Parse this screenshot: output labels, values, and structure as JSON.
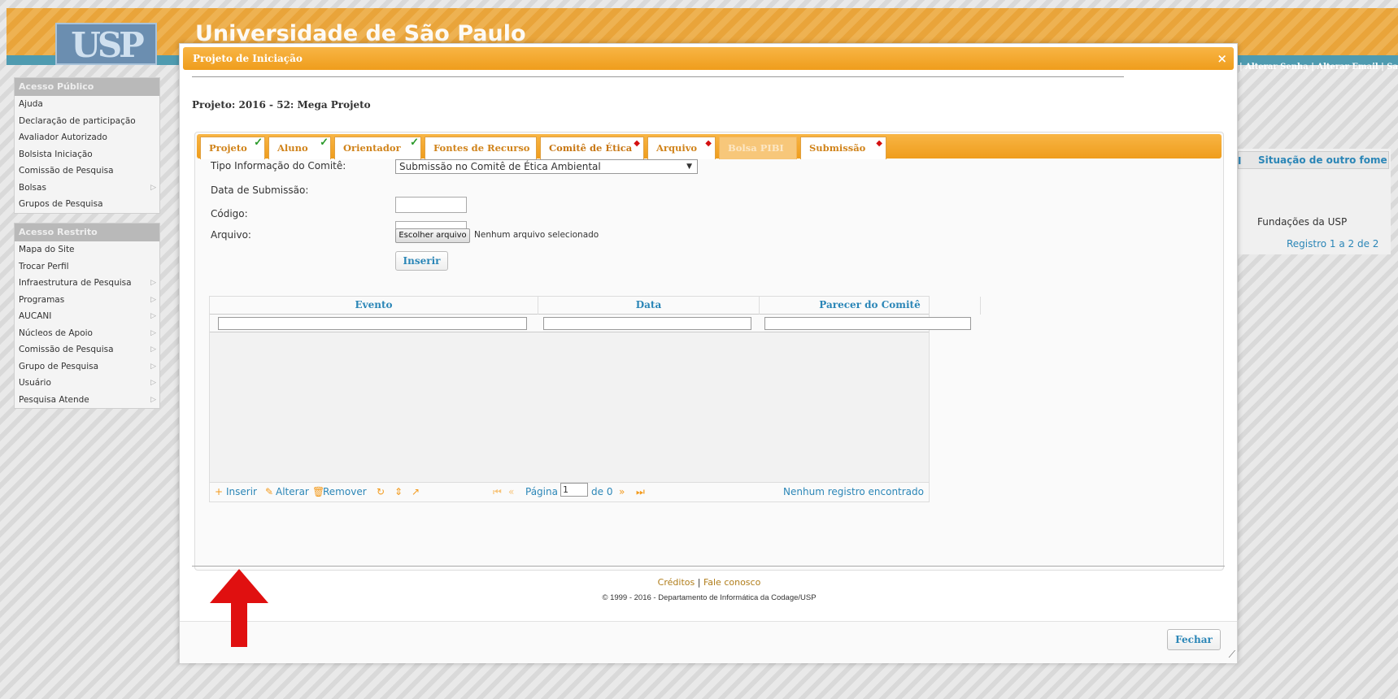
{
  "header": {
    "university": "Universidade de São Paulo",
    "logo_text": "USP",
    "top_links": "ce | Alterar Senha | Alterar Email | Sa"
  },
  "menu_public": {
    "title": "Acesso Público",
    "items": [
      "Ajuda",
      "Declaração de participação",
      "Avaliador Autorizado",
      "Bolsista Iniciação",
      "Comissão de Pesquisa",
      "Bolsas",
      "Grupos de Pesquisa"
    ]
  },
  "menu_restricted": {
    "title": "Acesso Restrito",
    "items": [
      "Mapa do Site",
      "Trocar Perfil",
      "Infraestrutura de Pesquisa",
      "Programas",
      "AUCANI",
      "Núcleos de Apoio",
      "Comissão de Pesquisa",
      "Grupo de Pesquisa",
      "Usuário",
      "Pesquisa Atende"
    ]
  },
  "background": {
    "col_head_short": "I",
    "col_head": "Situação de outro fome",
    "row_value": "Fundações da USP",
    "records": "Registro 1 a 2 de 2"
  },
  "modal": {
    "title": "Projeto de Iniciação",
    "close": "×",
    "project": "Projeto: 2016 - 52: Mega Projeto",
    "tabs": [
      {
        "label": "Projeto",
        "status": "ok"
      },
      {
        "label": "Aluno",
        "status": "ok"
      },
      {
        "label": "Orientador",
        "status": "ok"
      },
      {
        "label": "Fontes de Recurso",
        "status": ""
      },
      {
        "label": "Comitê de Ética",
        "status": "pending"
      },
      {
        "label": "Arquivo",
        "status": "pending"
      },
      {
        "label": "Bolsa PIBI",
        "status": "disabled"
      },
      {
        "label": "Submissão",
        "status": "pending"
      }
    ],
    "form": {
      "tipo_label": "Tipo Informação do Comitê:",
      "tipo_value": "Submissão no Comitê de Ética Ambiental",
      "data_label": "Data de Submissão:",
      "codigo_label": "Código:",
      "arquivo_label": "Arquivo:",
      "file_button": "Escolher arquivo",
      "file_none": "Nenhum arquivo selecionado",
      "insert_button": "Inserir"
    },
    "grid": {
      "columns": [
        "Evento",
        "Data",
        "Parecer do Comitê"
      ],
      "pager": {
        "insert": "Inserir",
        "edit": "Alterar",
        "remove": "Remover",
        "page_label": "Página",
        "page_value": "1",
        "of": "de 0",
        "empty": "Nenhum registro encontrado"
      }
    },
    "footer": {
      "credits": "Créditos",
      "sep": "|",
      "contact": "Fale conosco",
      "copyright": "© 1999 - 2016 - Departamento de Informática da Codage/USP",
      "close_button": "Fechar"
    }
  },
  "colors": {
    "orange": "#f3a230",
    "blue_link": "#2b86b7",
    "teal_bar": "#4f9bb0",
    "arrow": "#e01010"
  }
}
